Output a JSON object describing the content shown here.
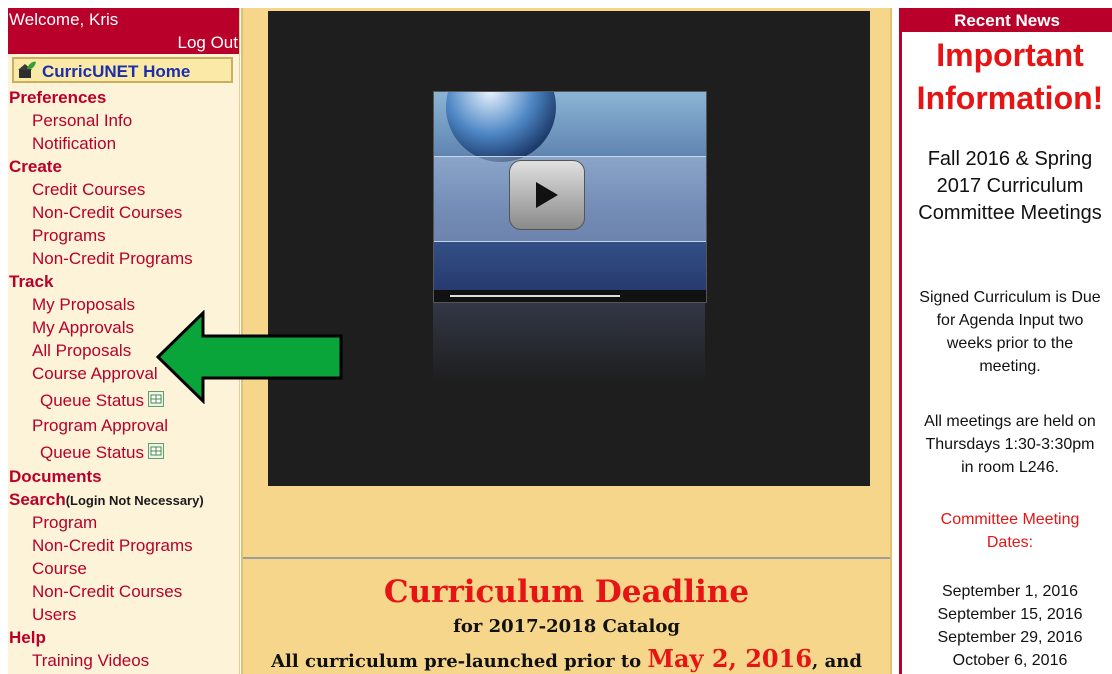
{
  "header": {
    "welcome": "Welcome, Kris",
    "logout": "Log Out"
  },
  "nav": {
    "home": "CurricUNET Home",
    "preferences": {
      "heading": "Preferences",
      "items": [
        "Personal Info",
        "Notification"
      ]
    },
    "create": {
      "heading": "Create",
      "items": [
        "Credit Courses",
        "Non-Credit Courses",
        "Programs",
        "Non-Credit Programs"
      ]
    },
    "track": {
      "heading": "Track",
      "items": [
        "My Proposals",
        "My Approvals",
        "All Proposals",
        "Course Approval",
        "Queue Status",
        "Program Approval",
        "Queue Status"
      ]
    },
    "documents": {
      "heading": "Documents"
    },
    "search": {
      "heading": "Search",
      "note": "(Login Not Necessary)",
      "items": [
        "Program",
        "Non-Credit Programs",
        "Course",
        "Non-Credit Courses",
        "Users"
      ]
    },
    "help": {
      "heading": "Help",
      "items": [
        "Training Videos"
      ]
    }
  },
  "center": {
    "deadline_title": "Curriculum Deadline",
    "deadline_subtitle": "for 2017-2018 Catalog",
    "deadline_body_before": "All curriculum pre-launched prior to ",
    "deadline_date": "May 2, 2016",
    "deadline_body_after": ", and"
  },
  "news": {
    "header": "Recent News",
    "important_line1": "Important",
    "important_line2": "Information!",
    "meetings_title_line1": "Fall 2016 & Spring",
    "meetings_title_line2": "2017 Curriculum",
    "meetings_title_line3": "Committee Meetings",
    "signed_line1": "Signed Curriculum is Due",
    "signed_line2": "for Agenda Input two",
    "signed_line3": "weeks prior to the",
    "signed_line4": "meeting.",
    "held_line1": "All meetings are held on",
    "held_line2": "Thursdays 1:30-3:30pm",
    "held_line3": "in room L246.",
    "dates_title_line1": "Committee Meeting",
    "dates_title_line2": "Dates:",
    "dates": [
      "September 1, 2016",
      "September 15, 2016",
      "September 29, 2016",
      "October 6, 2016"
    ]
  },
  "colors": {
    "brand": "#b8002b",
    "arrow_fill": "#0aa53a",
    "important_red": "#e61414",
    "center_bg": "#f5d68b",
    "nav_bg": "#fdf3d8"
  },
  "icons": {
    "home": "home-leaf-icon",
    "excel": "excel-icon",
    "play": "play-icon",
    "arrow": "arrow-left-icon"
  }
}
